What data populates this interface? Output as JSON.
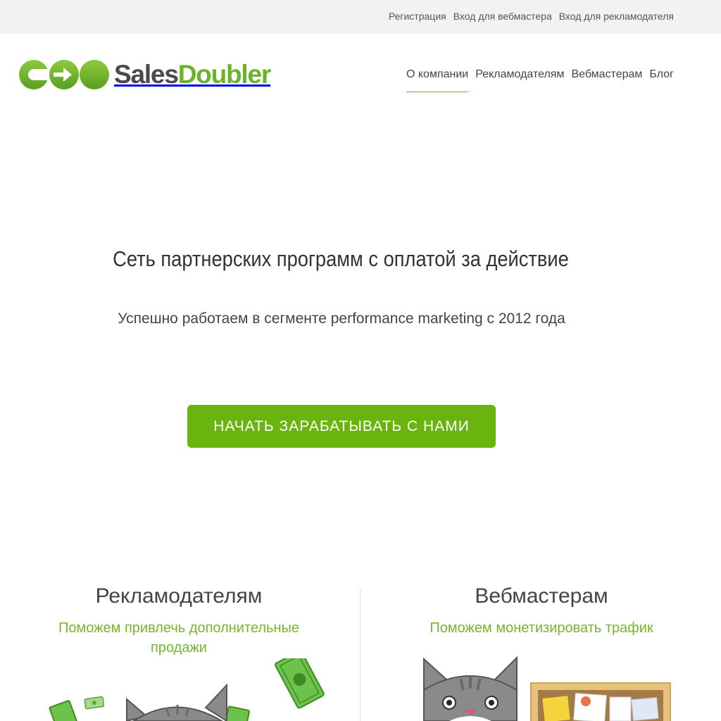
{
  "topbar": {
    "links": [
      "Регистрация",
      "Вход для вебмастера",
      "Вход для рекламодателя"
    ]
  },
  "logo": {
    "text_sales": "Sales",
    "text_doubler": "Doubler"
  },
  "nav": {
    "items": [
      "О компании",
      "Рекламодателям",
      "Вебмастерам",
      "Блог"
    ],
    "active": "О компании"
  },
  "hero": {
    "title": "Сеть партнерских программ с оплатой за действие",
    "subtitle": "Успешно работаем в сегменте performance marketing с 2012 года",
    "cta_label": "НАЧАТЬ ЗАРАБАТЫВАТЬ С НАМИ"
  },
  "sections": {
    "advertisers": {
      "title": "Рекламодателям",
      "subtitle": "Поможем привлечь дополнительные продажи"
    },
    "webmasters": {
      "title": "Вебмастерам",
      "subtitle": "Поможем монетизировать трафик"
    }
  },
  "colors": {
    "brand_green": "#6ab42a",
    "button_green": "#6ab40f",
    "topbar_bg": "#f2f2f2",
    "cat_gray": "#8a8a8a"
  },
  "icons": [
    "logo-mark-icon",
    "cat-with-money-illustration",
    "cat-with-corkboard-illustration"
  ]
}
